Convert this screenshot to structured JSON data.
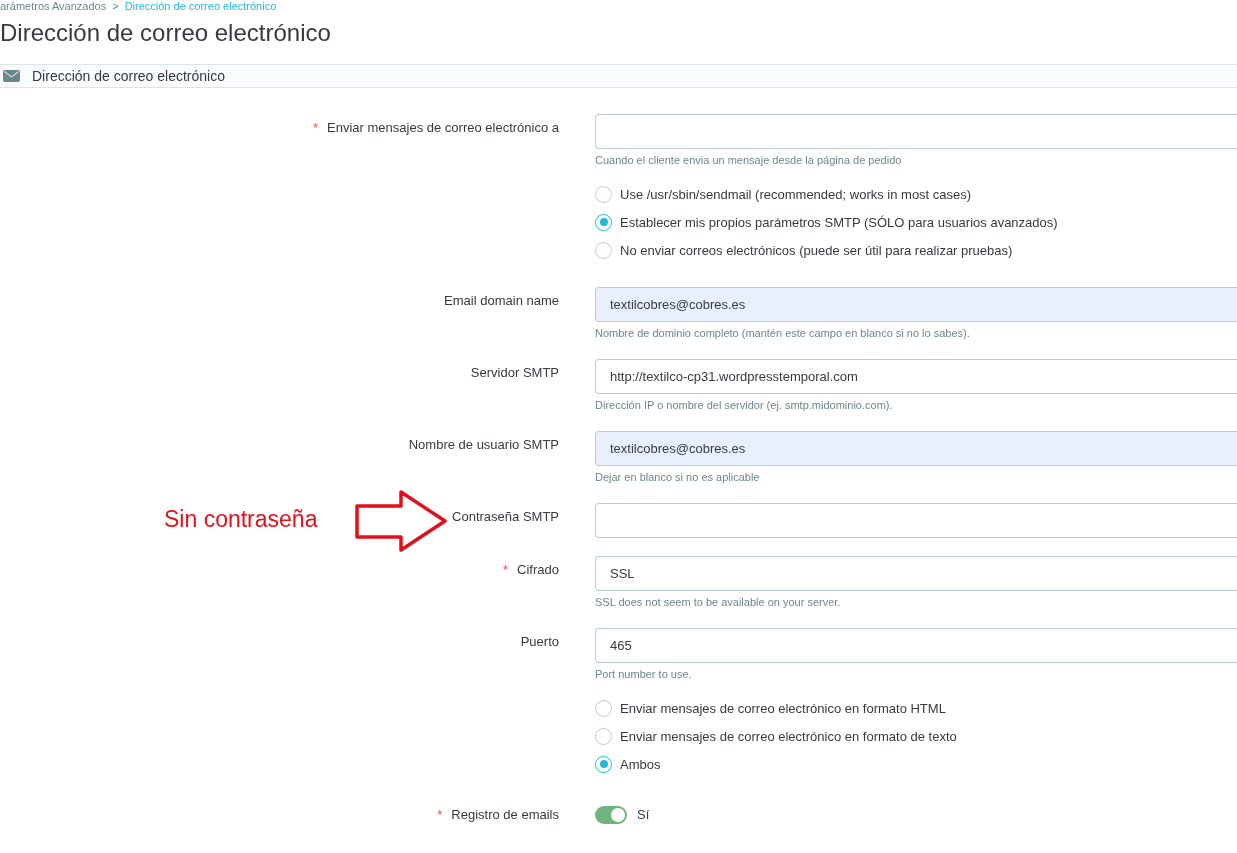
{
  "breadcrumb": {
    "separator": ">",
    "items": [
      {
        "label": "arámetros Avanzados",
        "current": false
      },
      {
        "label": "Dirección de correo electrónico",
        "current": true
      }
    ]
  },
  "page_title": "Dirección de correo electrónico",
  "card": {
    "title": "Dirección de correo electrónico",
    "rows": [
      {
        "kind": "text",
        "required_mark": "*",
        "label": "Enviar mensajes de correo electrónico a",
        "autofilled": false,
        "help": "Cuando el cliente envia un mensaje desde la página de pedido"
      },
      {
        "kind": "radio",
        "options": [
          {
            "label": "Use /usr/sbin/sendmail (recommended; works in most cases)",
            "selected": false
          },
          {
            "label": "Establecer mis propios parámetros SMTP (SÓLO para usuarios avanzados)",
            "selected": true
          },
          {
            "label": "No enviar correos electrónicos (puede ser útil para realizar pruebas)",
            "selected": false
          }
        ]
      },
      {
        "kind": "text",
        "label": "Email domain name",
        "value": "textilcobres@cobres.es",
        "autofilled": true,
        "help": "Nombre de dominio completo (mantén este campo en blanco si no lo sabes)."
      },
      {
        "kind": "text",
        "label": "Servidor SMTP",
        "value": "http://textilco-cp31.wordpresstemporal.com",
        "autofilled": false,
        "help": "Dirección IP o nombre del servidor (ej. smtp.midominio.com)."
      },
      {
        "kind": "text",
        "label": "Nombre de usuario SMTP",
        "value": "textilcobres@cobres.es",
        "autofilled": true,
        "help": "Dejar en blanco si no es aplicable"
      },
      {
        "kind": "text",
        "label": "Contraseña SMTP",
        "autofilled": false,
        "annotation": "Sin contraseña"
      },
      {
        "kind": "text",
        "required_mark": "*",
        "label": "Cifrado",
        "value": "SSL",
        "autofilled": false,
        "help": "SSL does not seem to be available on your server."
      },
      {
        "kind": "text",
        "label": "Puerto",
        "value": "465",
        "autofilled": false,
        "help": "Port number to use."
      },
      {
        "kind": "radio",
        "options": [
          {
            "label": "Enviar mensajes de correo electrónico en formato HTML",
            "selected": false
          },
          {
            "label": "Enviar mensajes de correo electrónico en formato de texto",
            "selected": false
          },
          {
            "label": "Ambos",
            "selected": true
          }
        ]
      },
      {
        "kind": "switch",
        "required_mark": "*",
        "label": "Registro de emails",
        "on": true,
        "state_label": "Sí"
      }
    ]
  }
}
